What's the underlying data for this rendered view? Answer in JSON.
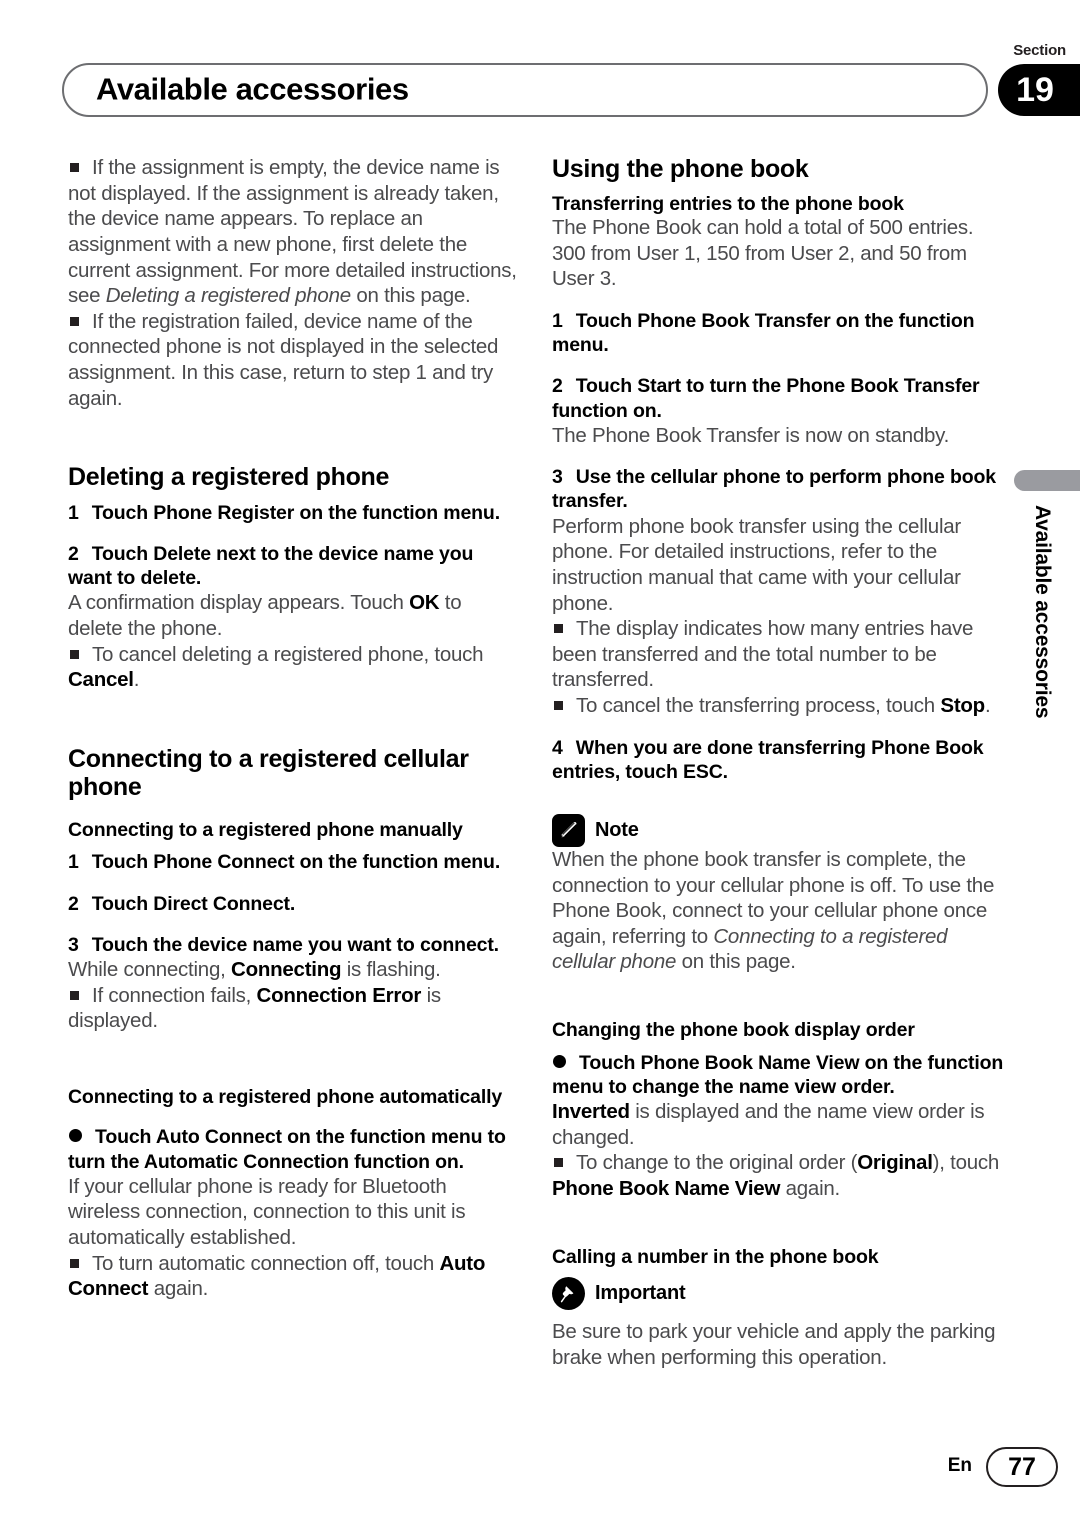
{
  "header": {
    "section_label": "Section",
    "section_number": "19",
    "title": "Available accessories"
  },
  "side_tab": {
    "label": "Available accessories"
  },
  "footer": {
    "language": "En",
    "page_number": "77"
  },
  "left_column": {
    "intro_bullets": [
      "If the assignment is empty, the device name is not displayed. If the assignment is already taken, the device name appears. To replace an assignment with a new phone, first delete the current assignment. For more detailed instructions, see ",
      "If the registration failed, device name of the connected phone is not displayed in the selected assignment. In this case, return to step 1 and try again."
    ],
    "intro_bullet1_italic": "Deleting a registered phone",
    "intro_bullet1_tail": " on this page.",
    "deleting": {
      "heading": "Deleting a registered phone",
      "step1_num": "1",
      "step1_text": "Touch Phone Register on the function menu.",
      "step2_num": "2",
      "step2_text": "Touch Delete next to the device name you want to delete.",
      "step2_body_pre": "A confirmation display appears. Touch ",
      "step2_body_bold": "OK",
      "step2_body_post": " to delete the phone.",
      "bullet_pre": "To cancel deleting a registered phone, touch ",
      "bullet_bold": "Cancel",
      "bullet_post": "."
    },
    "connecting": {
      "heading": "Connecting to a registered cellular phone",
      "sub1": "Connecting to a registered phone manually",
      "step1_num": "1",
      "step1_text": "Touch Phone Connect on the function menu.",
      "step2_num": "2",
      "step2_text": "Touch Direct Connect.",
      "step3_num": "3",
      "step3_text": "Touch the device name you want to connect.",
      "step3_body_pre": "While connecting, ",
      "step3_body_bold": "Connecting",
      "step3_body_post": " is flashing.",
      "bullet_pre": "If connection fails, ",
      "bullet_bold": "Connection Error",
      "bullet_post": " is displayed.",
      "sub2": "Connecting to a registered phone automatically",
      "auto_step_text": "Touch Auto Connect on the function menu to turn the Automatic Connection function on.",
      "auto_body": "If your cellular phone is ready for Bluetooth wireless connection, connection to this unit is automatically established.",
      "auto_bullet_pre": "To turn automatic connection off, touch ",
      "auto_bullet_bold": "Auto Connect",
      "auto_bullet_post": " again."
    }
  },
  "right_column": {
    "using_phone_book": {
      "heading": "Using the phone book",
      "sub1": "Transferring entries to the phone book",
      "intro": "The Phone Book can hold a total of 500 entries. 300 from User 1, 150 from User 2, and 50 from User 3.",
      "step1_num": "1",
      "step1_text": "Touch Phone Book Transfer on the function menu.",
      "step2_num": "2",
      "step2_text": "Touch Start to turn the Phone Book Transfer function on.",
      "step2_body": "The Phone Book Transfer is now on standby.",
      "step3_num": "3",
      "step3_text": "Use the cellular phone to perform phone book transfer.",
      "step3_body": "Perform phone book transfer using the cellular phone. For detailed instructions, refer to the instruction manual that came with your cellular phone.",
      "bullet1": "The display indicates how many entries have been transferred and the total number to be transferred.",
      "bullet2_pre": "To cancel the transferring process, touch ",
      "bullet2_bold": "Stop",
      "bullet2_post": ".",
      "step4_num": "4",
      "step4_text": "When you are done transferring Phone Book entries, touch ESC.",
      "note_label": "Note",
      "note_body_pre": "When the phone book transfer is complete, the connection to your cellular phone is off. To use the Phone Book, connect to your cellular phone once again, referring to ",
      "note_body_italic": "Connecting to a registered cellular phone",
      "note_body_post": " on this page."
    },
    "display_order": {
      "sub2": "Changing the phone book display order",
      "dot_step_text": "Touch Phone Book Name View on the function menu to change the name view order.",
      "body_bold": "Inverted",
      "body_post": " is displayed and the name view order is changed.",
      "bullet_pre": "To change to the original order (",
      "bullet_bold1": "Original",
      "bullet_mid": "), touch ",
      "bullet_bold2": "Phone Book Name View",
      "bullet_post": " again."
    },
    "calling": {
      "sub3": "Calling a number in the phone book",
      "important_label": "Important",
      "important_body": "Be sure to park your vehicle and apply the parking brake when performing this operation."
    }
  }
}
